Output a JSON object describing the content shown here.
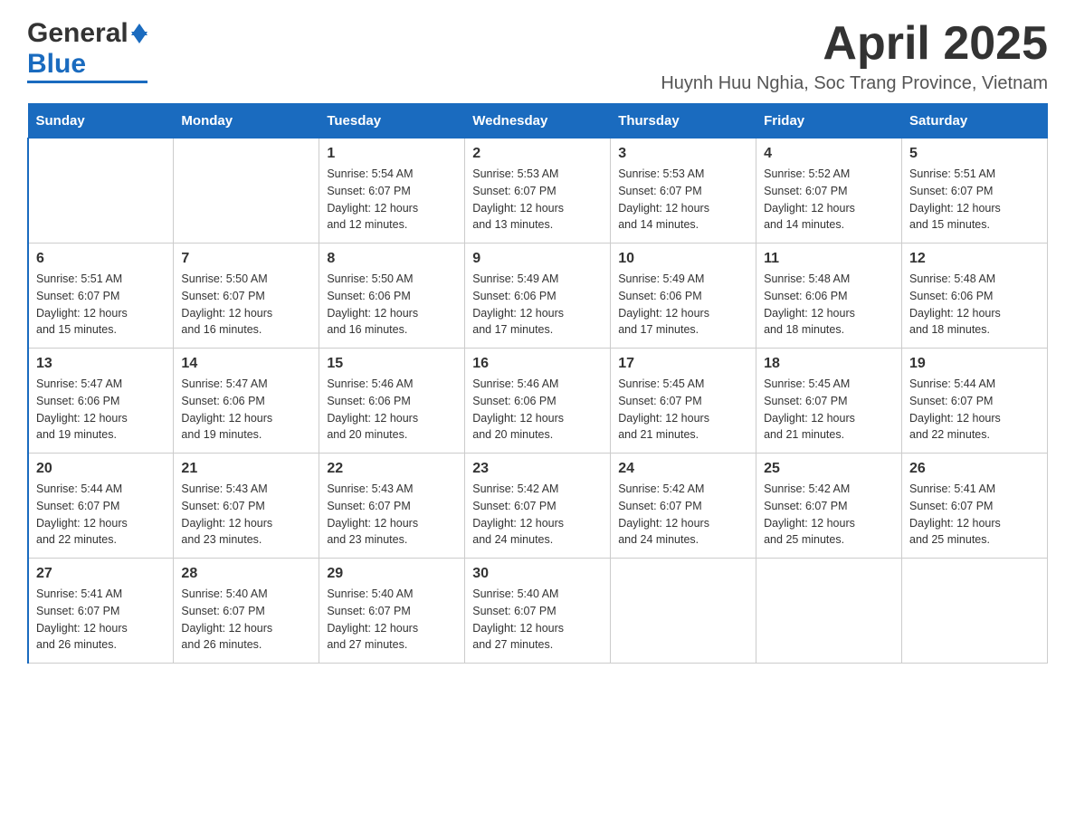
{
  "header": {
    "logo_general": "General",
    "logo_blue": "Blue",
    "month_title": "April 2025",
    "location": "Huynh Huu Nghia, Soc Trang Province, Vietnam"
  },
  "weekdays": [
    "Sunday",
    "Monday",
    "Tuesday",
    "Wednesday",
    "Thursday",
    "Friday",
    "Saturday"
  ],
  "weeks": [
    [
      {
        "day": "",
        "info": ""
      },
      {
        "day": "",
        "info": ""
      },
      {
        "day": "1",
        "info": "Sunrise: 5:54 AM\nSunset: 6:07 PM\nDaylight: 12 hours\nand 12 minutes."
      },
      {
        "day": "2",
        "info": "Sunrise: 5:53 AM\nSunset: 6:07 PM\nDaylight: 12 hours\nand 13 minutes."
      },
      {
        "day": "3",
        "info": "Sunrise: 5:53 AM\nSunset: 6:07 PM\nDaylight: 12 hours\nand 14 minutes."
      },
      {
        "day": "4",
        "info": "Sunrise: 5:52 AM\nSunset: 6:07 PM\nDaylight: 12 hours\nand 14 minutes."
      },
      {
        "day": "5",
        "info": "Sunrise: 5:51 AM\nSunset: 6:07 PM\nDaylight: 12 hours\nand 15 minutes."
      }
    ],
    [
      {
        "day": "6",
        "info": "Sunrise: 5:51 AM\nSunset: 6:07 PM\nDaylight: 12 hours\nand 15 minutes."
      },
      {
        "day": "7",
        "info": "Sunrise: 5:50 AM\nSunset: 6:07 PM\nDaylight: 12 hours\nand 16 minutes."
      },
      {
        "day": "8",
        "info": "Sunrise: 5:50 AM\nSunset: 6:06 PM\nDaylight: 12 hours\nand 16 minutes."
      },
      {
        "day": "9",
        "info": "Sunrise: 5:49 AM\nSunset: 6:06 PM\nDaylight: 12 hours\nand 17 minutes."
      },
      {
        "day": "10",
        "info": "Sunrise: 5:49 AM\nSunset: 6:06 PM\nDaylight: 12 hours\nand 17 minutes."
      },
      {
        "day": "11",
        "info": "Sunrise: 5:48 AM\nSunset: 6:06 PM\nDaylight: 12 hours\nand 18 minutes."
      },
      {
        "day": "12",
        "info": "Sunrise: 5:48 AM\nSunset: 6:06 PM\nDaylight: 12 hours\nand 18 minutes."
      }
    ],
    [
      {
        "day": "13",
        "info": "Sunrise: 5:47 AM\nSunset: 6:06 PM\nDaylight: 12 hours\nand 19 minutes."
      },
      {
        "day": "14",
        "info": "Sunrise: 5:47 AM\nSunset: 6:06 PM\nDaylight: 12 hours\nand 19 minutes."
      },
      {
        "day": "15",
        "info": "Sunrise: 5:46 AM\nSunset: 6:06 PM\nDaylight: 12 hours\nand 20 minutes."
      },
      {
        "day": "16",
        "info": "Sunrise: 5:46 AM\nSunset: 6:06 PM\nDaylight: 12 hours\nand 20 minutes."
      },
      {
        "day": "17",
        "info": "Sunrise: 5:45 AM\nSunset: 6:07 PM\nDaylight: 12 hours\nand 21 minutes."
      },
      {
        "day": "18",
        "info": "Sunrise: 5:45 AM\nSunset: 6:07 PM\nDaylight: 12 hours\nand 21 minutes."
      },
      {
        "day": "19",
        "info": "Sunrise: 5:44 AM\nSunset: 6:07 PM\nDaylight: 12 hours\nand 22 minutes."
      }
    ],
    [
      {
        "day": "20",
        "info": "Sunrise: 5:44 AM\nSunset: 6:07 PM\nDaylight: 12 hours\nand 22 minutes."
      },
      {
        "day": "21",
        "info": "Sunrise: 5:43 AM\nSunset: 6:07 PM\nDaylight: 12 hours\nand 23 minutes."
      },
      {
        "day": "22",
        "info": "Sunrise: 5:43 AM\nSunset: 6:07 PM\nDaylight: 12 hours\nand 23 minutes."
      },
      {
        "day": "23",
        "info": "Sunrise: 5:42 AM\nSunset: 6:07 PM\nDaylight: 12 hours\nand 24 minutes."
      },
      {
        "day": "24",
        "info": "Sunrise: 5:42 AM\nSunset: 6:07 PM\nDaylight: 12 hours\nand 24 minutes."
      },
      {
        "day": "25",
        "info": "Sunrise: 5:42 AM\nSunset: 6:07 PM\nDaylight: 12 hours\nand 25 minutes."
      },
      {
        "day": "26",
        "info": "Sunrise: 5:41 AM\nSunset: 6:07 PM\nDaylight: 12 hours\nand 25 minutes."
      }
    ],
    [
      {
        "day": "27",
        "info": "Sunrise: 5:41 AM\nSunset: 6:07 PM\nDaylight: 12 hours\nand 26 minutes."
      },
      {
        "day": "28",
        "info": "Sunrise: 5:40 AM\nSunset: 6:07 PM\nDaylight: 12 hours\nand 26 minutes."
      },
      {
        "day": "29",
        "info": "Sunrise: 5:40 AM\nSunset: 6:07 PM\nDaylight: 12 hours\nand 27 minutes."
      },
      {
        "day": "30",
        "info": "Sunrise: 5:40 AM\nSunset: 6:07 PM\nDaylight: 12 hours\nand 27 minutes."
      },
      {
        "day": "",
        "info": ""
      },
      {
        "day": "",
        "info": ""
      },
      {
        "day": "",
        "info": ""
      }
    ]
  ]
}
